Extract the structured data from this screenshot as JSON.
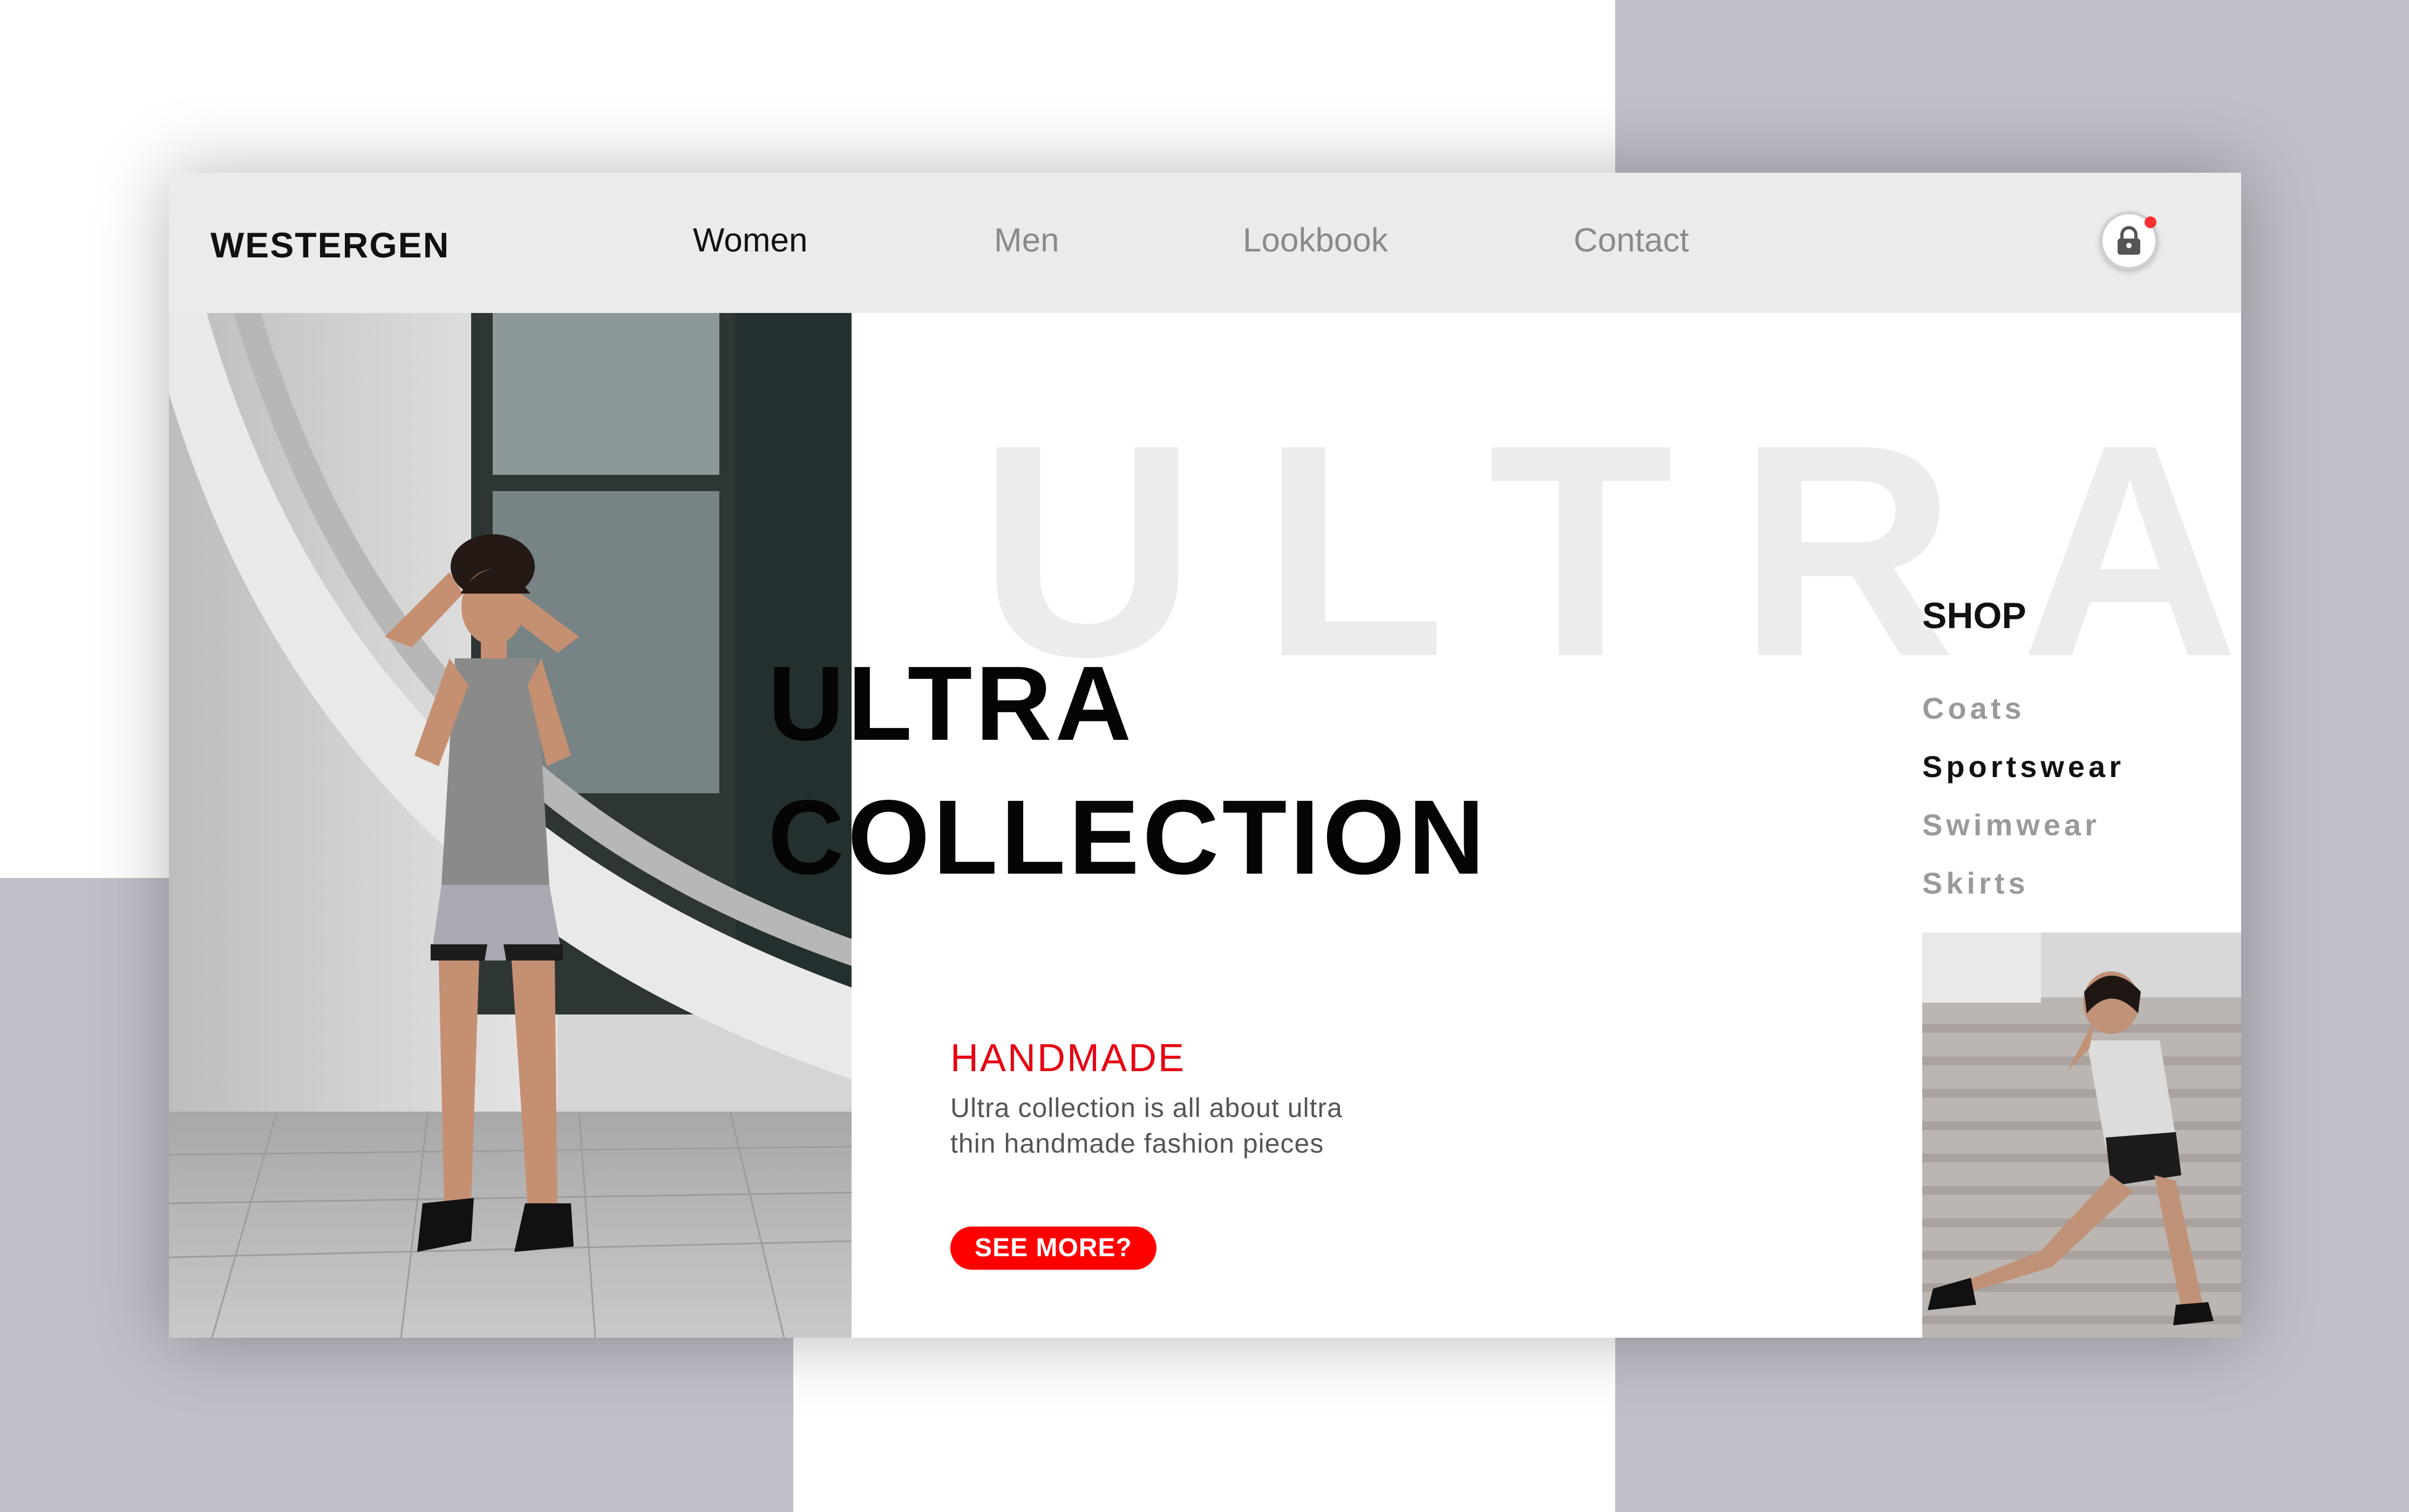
{
  "header": {
    "logo": "WESTERGEN",
    "nav": [
      {
        "label": "Women",
        "active": true
      },
      {
        "label": "Men",
        "active": false
      },
      {
        "label": "Lookbook",
        "active": false
      },
      {
        "label": "Contact",
        "active": false
      }
    ],
    "cart_icon": "shopping-bag-lock-icon",
    "cart_notification_color": "#ff3030"
  },
  "hero": {
    "watermark": "ULTRA",
    "headline_line1": "ULTRA",
    "headline_line2": "COLLECTION",
    "tag": "HANDMADE",
    "desc_line1": "Ultra collection is all about ultra",
    "desc_line2": "thin handmade fashion pieces",
    "cta_label": "SEE MORE?"
  },
  "shop": {
    "title": "SHOP",
    "items": [
      {
        "label": "Coats",
        "active": false
      },
      {
        "label": "Sportswear",
        "active": true
      },
      {
        "label": "Swimwear",
        "active": false
      },
      {
        "label": "Skirts",
        "active": false
      }
    ]
  },
  "colors": {
    "accent": "#ff0000",
    "tag_red": "#e60012",
    "header_bg": "#ebebeb",
    "backdrop": "#bfbfc9"
  }
}
